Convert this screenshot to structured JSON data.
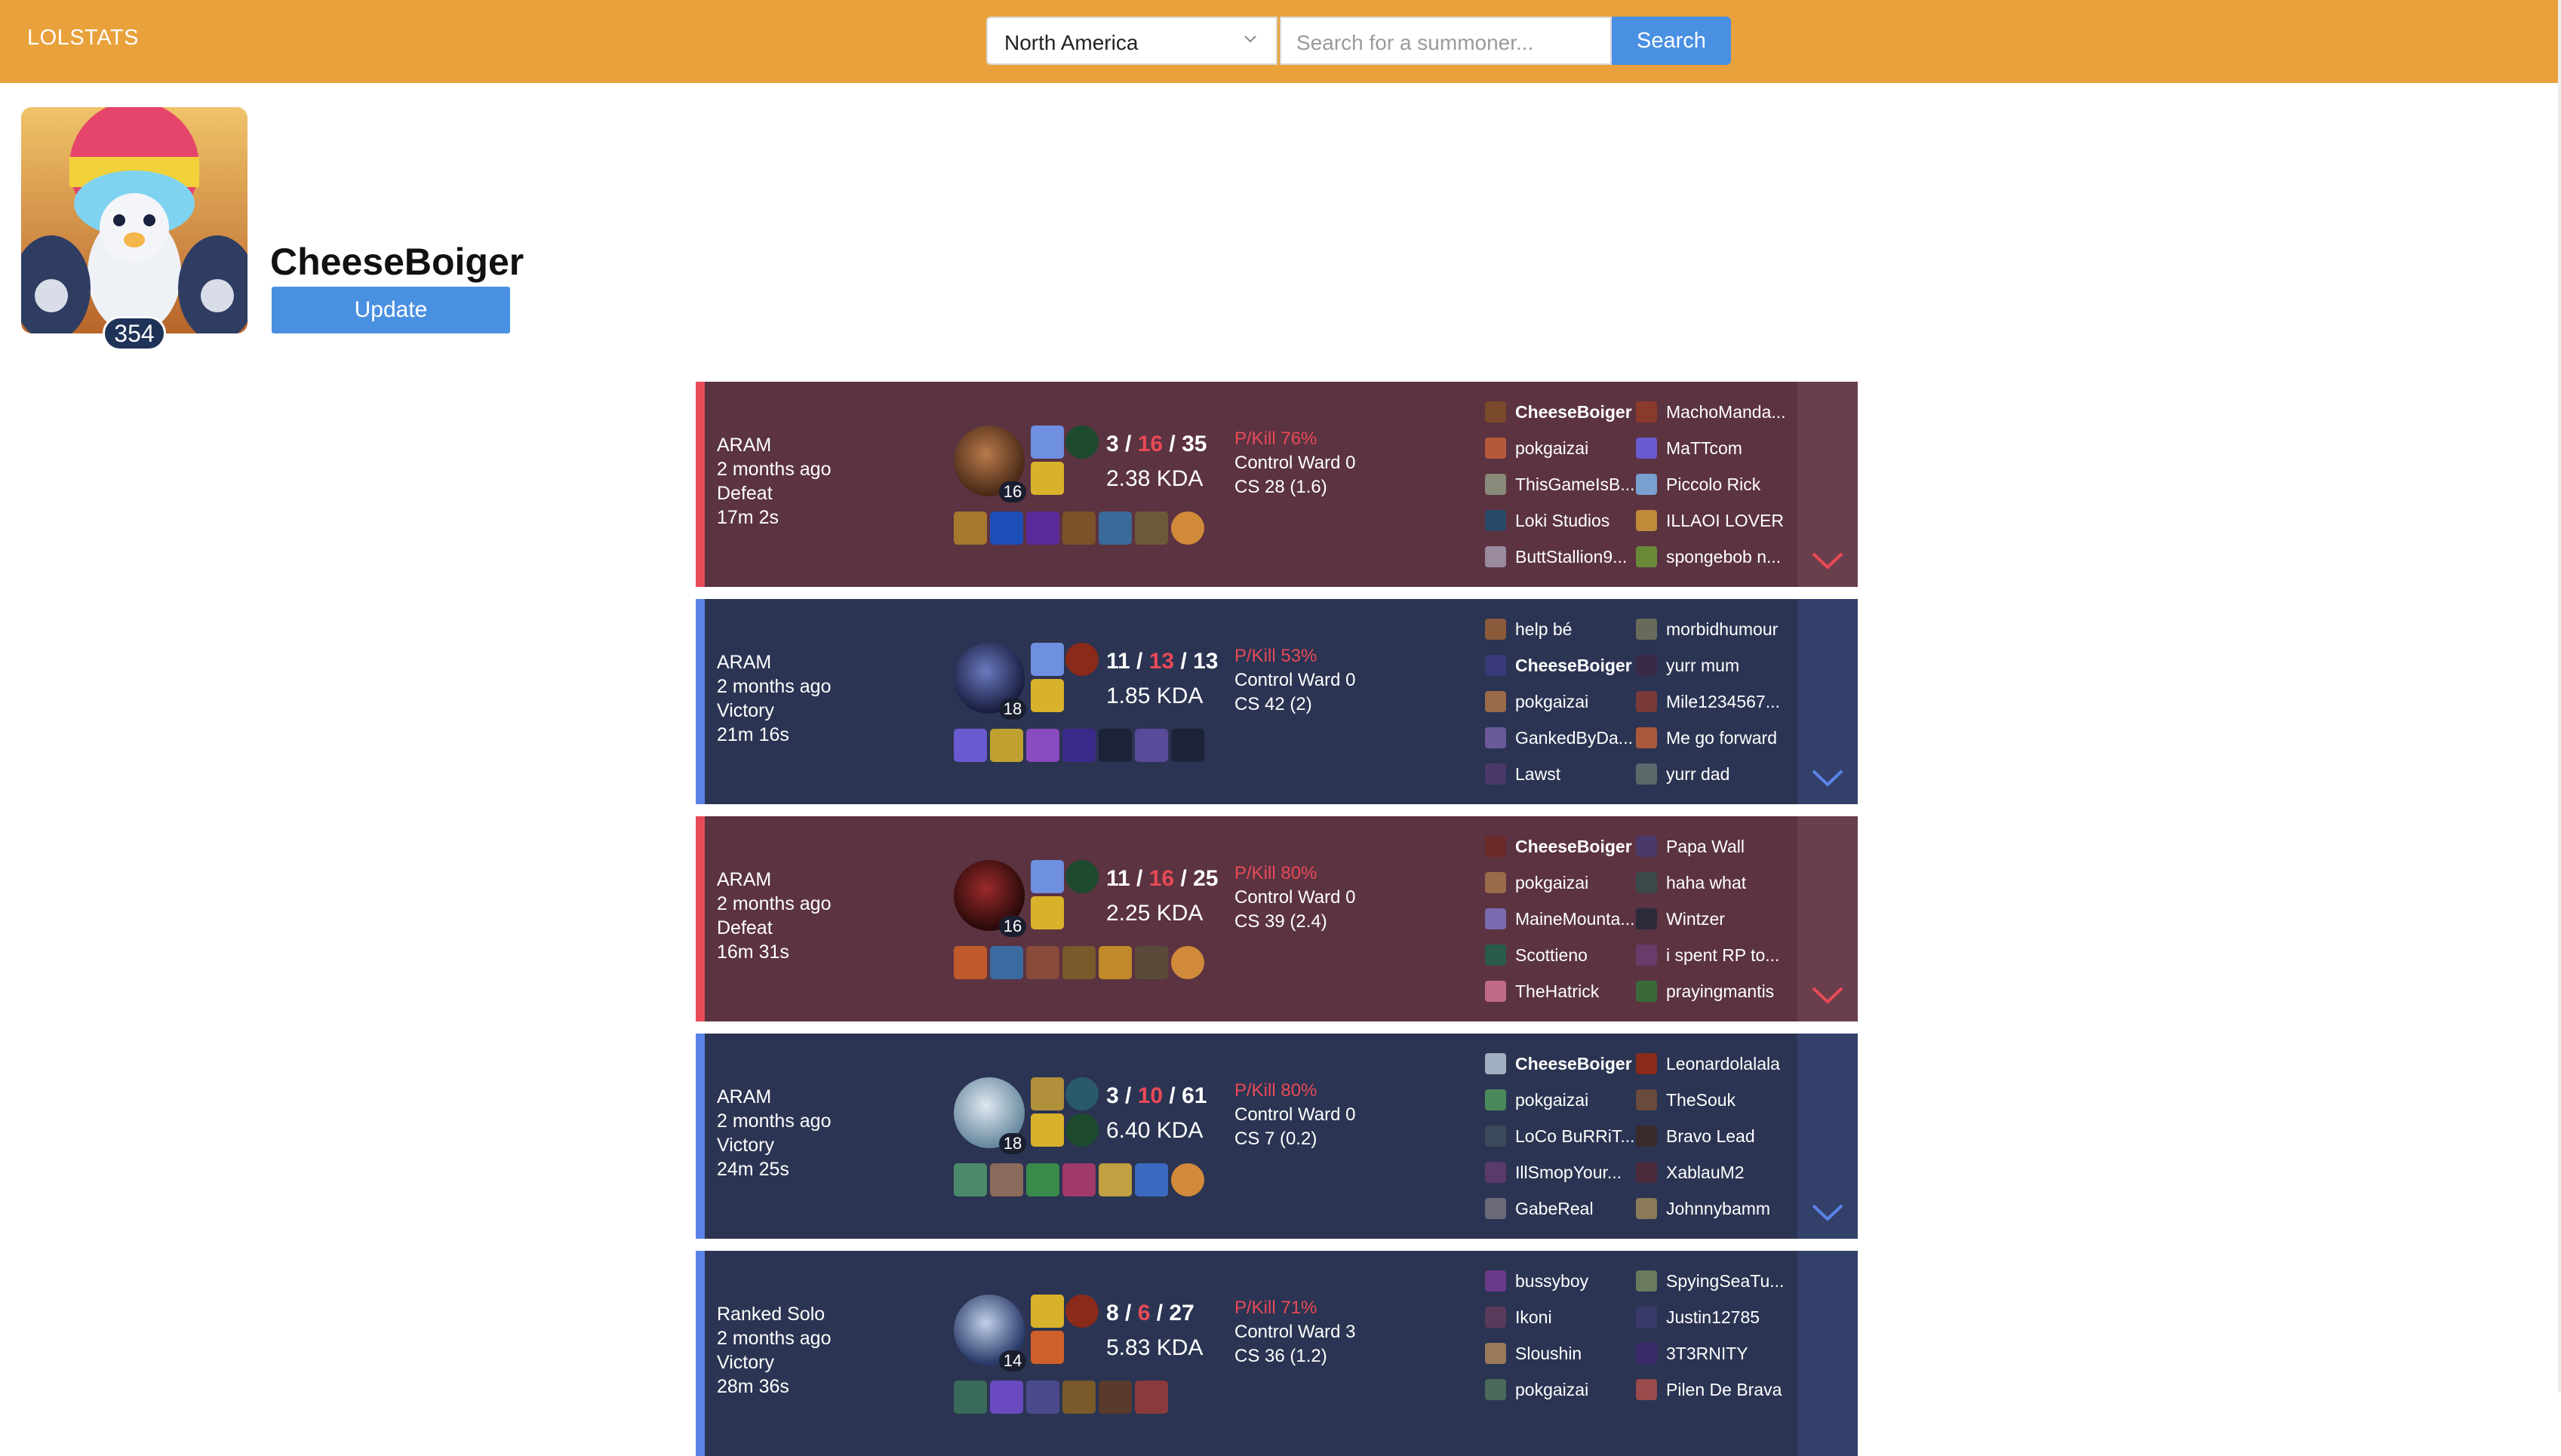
{
  "navbar": {
    "brand": "LOLSTATS",
    "region": "North America",
    "search_placeholder": "Search for a summoner...",
    "search_label": "Search"
  },
  "profile": {
    "level": "354",
    "name": "CheeseBoiger",
    "update_label": "Update"
  },
  "matches": [
    {
      "queue": "ARAM",
      "when": "2 months ago",
      "result": "Defeat",
      "duration": "17m 2s",
      "champ_level": "16",
      "kills": "3",
      "deaths": "16",
      "assists": "35",
      "kda": "2.38 KDA",
      "pkill": "P/Kill 76%",
      "ward": "Control Ward 0",
      "cs": "CS 28 (1.6)",
      "team1": [
        "CheeseBoiger",
        "pokgaizai",
        "ThisGameIsB...",
        "Loki Studios",
        "ButtStallion9..."
      ],
      "team2": [
        "MachoManda...",
        "MaTTcom",
        "Piccolo Rick",
        "ILLAOI LOVER",
        "spongebob n..."
      ]
    },
    {
      "queue": "ARAM",
      "when": "2 months ago",
      "result": "Victory",
      "duration": "21m 16s",
      "champ_level": "18",
      "kills": "11",
      "deaths": "13",
      "assists": "13",
      "kda": "1.85 KDA",
      "pkill": "P/Kill 53%",
      "ward": "Control Ward 0",
      "cs": "CS 42 (2)",
      "team1": [
        "help bé",
        "CheeseBoiger",
        "pokgaizai",
        "GankedByDa...",
        "Lawst"
      ],
      "team2": [
        "morbidhumour",
        "yurr mum",
        "Mile1234567...",
        "Me go forward",
        "yurr dad"
      ]
    },
    {
      "queue": "ARAM",
      "when": "2 months ago",
      "result": "Defeat",
      "duration": "16m 31s",
      "champ_level": "16",
      "kills": "11",
      "deaths": "16",
      "assists": "25",
      "kda": "2.25 KDA",
      "pkill": "P/Kill 80%",
      "ward": "Control Ward 0",
      "cs": "CS 39 (2.4)",
      "team1": [
        "CheeseBoiger",
        "pokgaizai",
        "MaineMounta...",
        "Scottieno",
        "TheHatrick"
      ],
      "team2": [
        "Papa Wall",
        "haha what",
        "Wintzer",
        "i spent RP to...",
        "prayingmantis"
      ]
    },
    {
      "queue": "ARAM",
      "when": "2 months ago",
      "result": "Victory",
      "duration": "24m 25s",
      "champ_level": "18",
      "kills": "3",
      "deaths": "10",
      "assists": "61",
      "kda": "6.40 KDA",
      "pkill": "P/Kill 80%",
      "ward": "Control Ward 0",
      "cs": "CS 7 (0.2)",
      "team1": [
        "CheeseBoiger",
        "pokgaizai",
        "LoCo BuRRiT...",
        "IllSmopYour...",
        "GabeReal"
      ],
      "team2": [
        "Leonardolalala",
        "TheSouk",
        "Bravo Lead",
        "XablauM2",
        "Johnnybamm"
      ]
    },
    {
      "queue": "Ranked Solo",
      "when": "2 months ago",
      "result": "Victory",
      "duration": "28m 36s",
      "champ_level": "14",
      "kills": "8",
      "deaths": "6",
      "assists": "27",
      "kda": "5.83 KDA",
      "pkill": "P/Kill 71%",
      "ward": "Control Ward 3",
      "cs": "CS 36 (1.2)",
      "team1": [
        "bussyboy",
        "Ikoni",
        "Sloushin",
        "pokgaizai",
        ""
      ],
      "team2": [
        "SpyingSeaTu...",
        "Justin12785",
        "3T3RNITY",
        "Pilen De Brava",
        ""
      ]
    }
  ],
  "colors": {
    "accent": "#e9a13b",
    "button": "#4a90e2",
    "defeat_bg": "#5b3341",
    "victory_bg": "#2b3452",
    "defeat_bar": "#e84a57",
    "victory_bar": "#5a83e8"
  }
}
